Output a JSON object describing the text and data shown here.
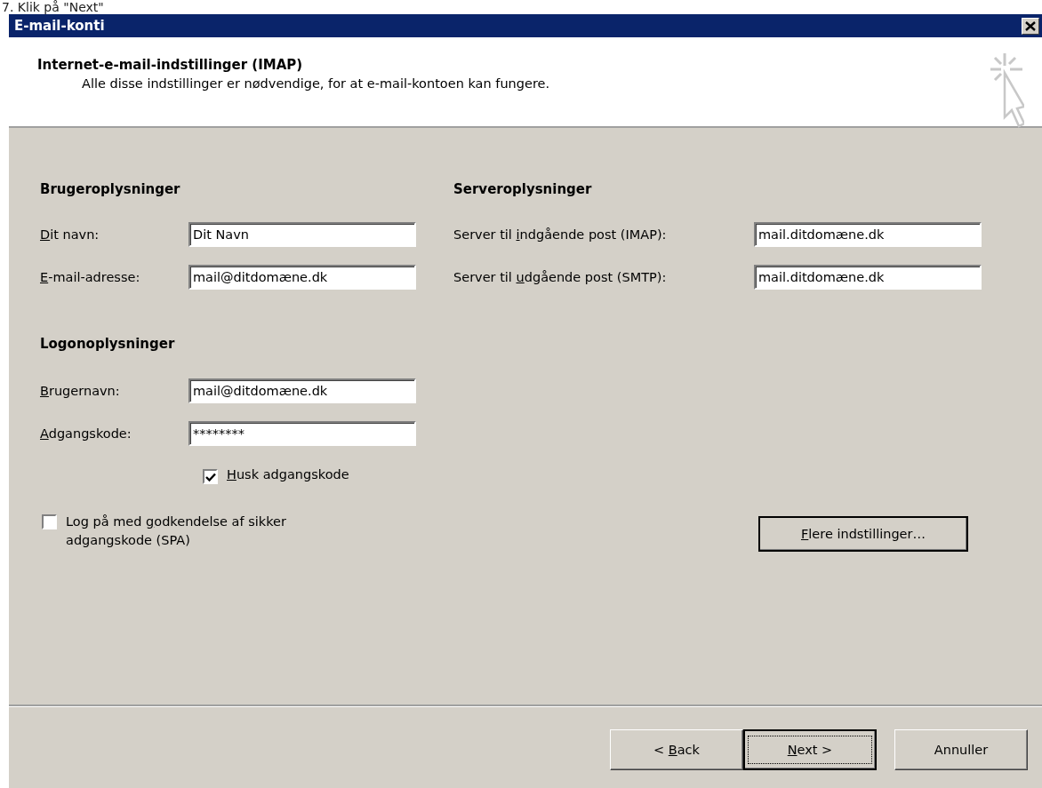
{
  "caption": "7. Klik på \"Next\"",
  "window": {
    "title": "E-mail-konti"
  },
  "header": {
    "title": "Internet-e-mail-indstillinger (IMAP)",
    "subtitle": "Alle disse indstillinger er nødvendige, for at e-mail-kontoen kan fungere."
  },
  "user_section": {
    "title": "Brugeroplysninger",
    "fields": [
      {
        "label": {
          "access": "D",
          "post": "it navn:"
        },
        "value": "Dit Navn"
      },
      {
        "label": {
          "access": "E",
          "post": "-mail-adresse:"
        },
        "value": "mail@ditdomæne.dk"
      }
    ]
  },
  "server_section": {
    "title": "Serveroplysninger",
    "fields": [
      {
        "label": {
          "pre": "Server til ",
          "access": "i",
          "post": "ndgående post (IMAP):"
        },
        "value": "mail.ditdomæne.dk"
      },
      {
        "label": {
          "pre": "Server til ",
          "access": "u",
          "post": "dgående post (SMTP):"
        },
        "value": "mail.ditdomæne.dk"
      }
    ]
  },
  "logon_section": {
    "title": "Logonoplysninger",
    "fields": [
      {
        "label": {
          "access": "B",
          "post": "rugernavn:"
        },
        "value": "mail@ditdomæne.dk"
      },
      {
        "label": {
          "access": "A",
          "post": "dgangskode:"
        },
        "value": "********"
      }
    ],
    "remember": {
      "label": {
        "access": "H",
        "post": "usk adgangskode"
      },
      "checked": true
    }
  },
  "spa": {
    "label": {
      "pre": "Log på med ",
      "access": "g",
      "post": "odkendelse af sikker adgangskode (SPA)"
    },
    "checked": false
  },
  "more_button": {
    "label": {
      "access": "F",
      "post": "lere indstillinger…"
    }
  },
  "buttons": [
    {
      "label": {
        "pre": "< ",
        "access": "B",
        "post": "ack"
      },
      "default": false
    },
    {
      "label": {
        "access": "N",
        "post": "ext >"
      },
      "default": true
    },
    {
      "label": {
        "pre": "Annuller"
      },
      "default": false
    }
  ]
}
